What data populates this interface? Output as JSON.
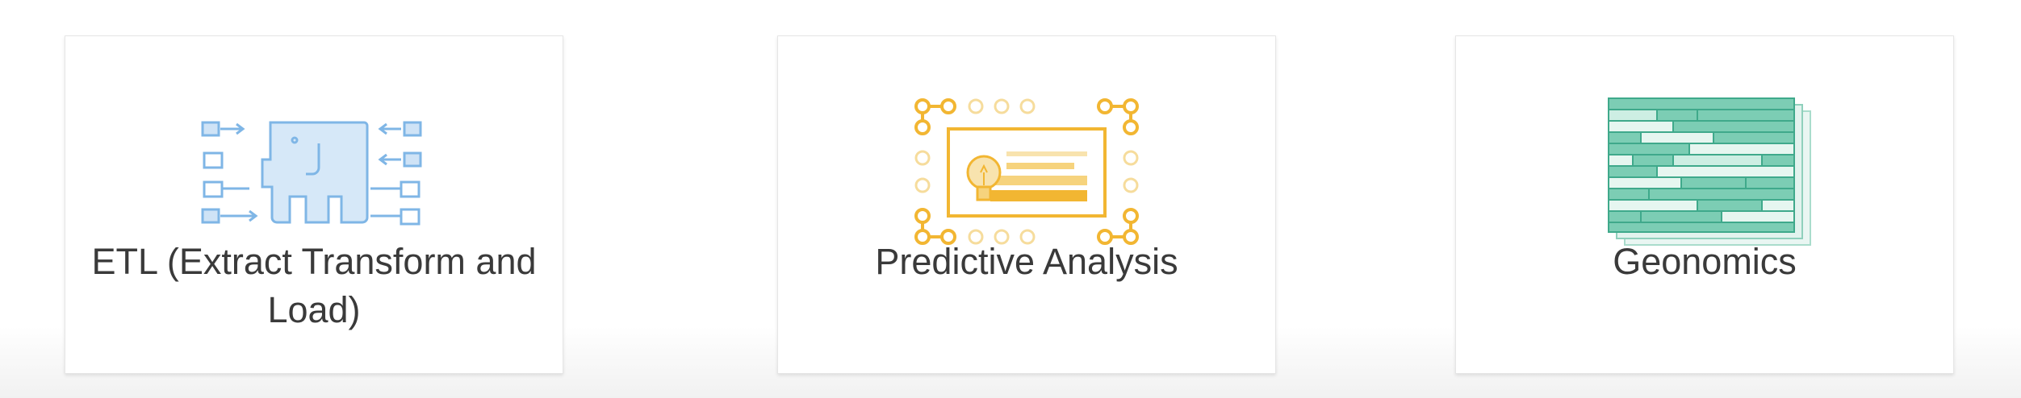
{
  "cards": [
    {
      "label": "ETL (Extract Transform and Load)",
      "icon": "elephant-pipeline-icon",
      "color": "#7fb6e6"
    },
    {
      "label": "Predictive Analysis",
      "icon": "lightbulb-chart-icon",
      "color": "#f2b632"
    },
    {
      "label": "Geonomics",
      "icon": "genome-grid-icon",
      "color": "#4cb89a"
    }
  ]
}
